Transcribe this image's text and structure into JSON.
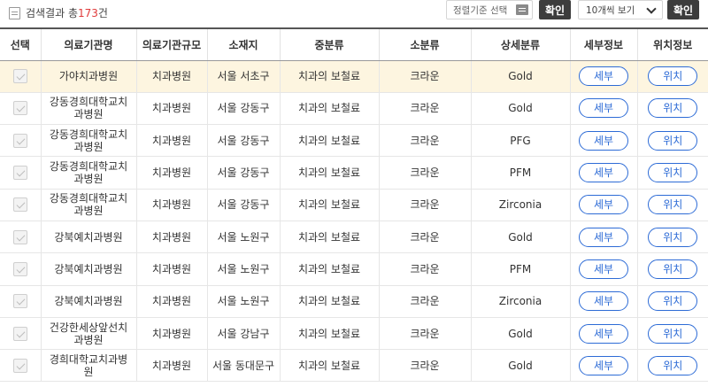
{
  "header": {
    "result_prefix": "검색결과 총",
    "result_count": "173",
    "result_suffix": "건",
    "sort_placeholder": "정렬기준 선택",
    "confirm_label": "확인",
    "perpage_value": "10개씩 보기",
    "confirm2_label": "확인"
  },
  "table": {
    "columns": [
      "선택",
      "의료기관명",
      "의료기관규모",
      "소재지",
      "중분류",
      "소분류",
      "상세분류",
      "세부정보",
      "위치정보"
    ],
    "detail_label": "세부",
    "location_label": "위치",
    "rows": [
      {
        "name": "가야치과병원",
        "size": "치과병원",
        "loc": "서울 서초구",
        "mid": "치과의 보철료",
        "sub": "크라운",
        "detail": "Gold"
      },
      {
        "name": "강동경희대학교치과병원",
        "size": "치과병원",
        "loc": "서울 강동구",
        "mid": "치과의 보철료",
        "sub": "크라운",
        "detail": "Gold"
      },
      {
        "name": "강동경희대학교치과병원",
        "size": "치과병원",
        "loc": "서울 강동구",
        "mid": "치과의 보철료",
        "sub": "크라운",
        "detail": "PFG"
      },
      {
        "name": "강동경희대학교치과병원",
        "size": "치과병원",
        "loc": "서울 강동구",
        "mid": "치과의 보철료",
        "sub": "크라운",
        "detail": "PFM"
      },
      {
        "name": "강동경희대학교치과병원",
        "size": "치과병원",
        "loc": "서울 강동구",
        "mid": "치과의 보철료",
        "sub": "크라운",
        "detail": "Zirconia"
      },
      {
        "name": "강북예치과병원",
        "size": "치과병원",
        "loc": "서울 노원구",
        "mid": "치과의 보철료",
        "sub": "크라운",
        "detail": "Gold"
      },
      {
        "name": "강북예치과병원",
        "size": "치과병원",
        "loc": "서울 노원구",
        "mid": "치과의 보철료",
        "sub": "크라운",
        "detail": "PFM"
      },
      {
        "name": "강북예치과병원",
        "size": "치과병원",
        "loc": "서울 노원구",
        "mid": "치과의 보철료",
        "sub": "크라운",
        "detail": "Zirconia"
      },
      {
        "name": "건강한세상앞선치과병원",
        "size": "치과병원",
        "loc": "서울 강남구",
        "mid": "치과의 보철료",
        "sub": "크라운",
        "detail": "Gold"
      },
      {
        "name": "경희대학교치과병원",
        "size": "치과병원",
        "loc": "서울 동대문구",
        "mid": "치과의 보철료",
        "sub": "크라운",
        "detail": "Gold"
      }
    ]
  }
}
